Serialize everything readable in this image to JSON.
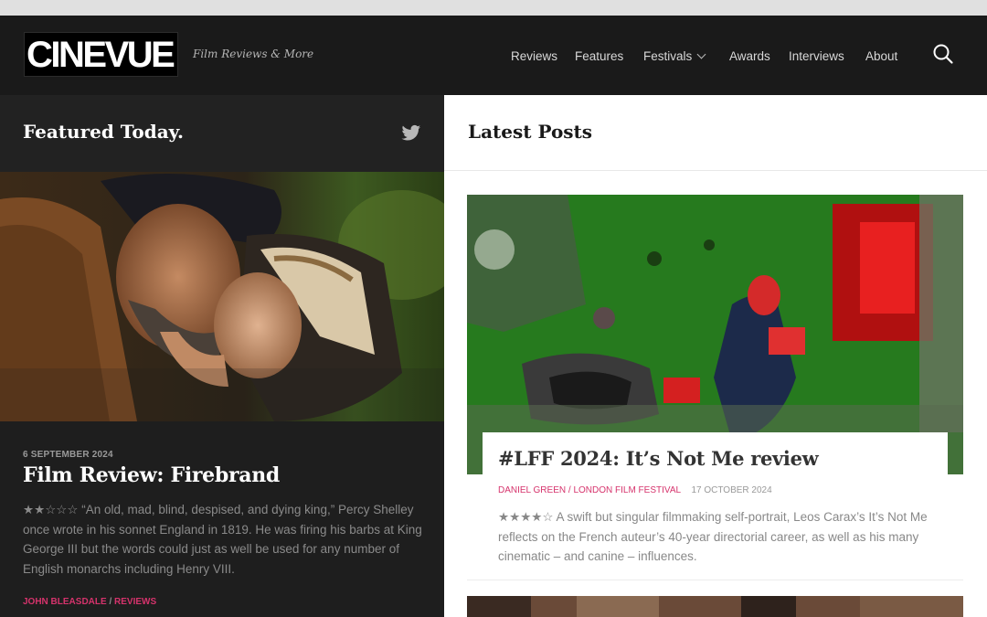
{
  "site": {
    "logo_text": "CINEVUE",
    "tagline": "Film Reviews & More"
  },
  "nav": {
    "items": [
      {
        "label": "Reviews"
      },
      {
        "label": "Features"
      },
      {
        "label": "Festivals"
      },
      {
        "label": "Awards"
      },
      {
        "label": "Interviews"
      },
      {
        "label": "About"
      }
    ],
    "icons": {
      "dropdown": "chevron-down-icon",
      "search": "search-icon"
    }
  },
  "featured": {
    "heading": "Featured Today.",
    "social_icon": "twitter-icon",
    "article": {
      "date": "6 SEPTEMBER 2024",
      "title": "Film Review: Firebrand",
      "rating": "★★☆☆☆",
      "excerpt": "“An old, mad, blind, despised, and dying king,” Percy Shelley once wrote in his sonnet England in 1819. He was firing his barbs at King George III but the words could just as well be used for any number of English monarchs including Henry VIII.",
      "author": "JOHN BLEASDALE",
      "separator": "/",
      "category": "REVIEWS"
    }
  },
  "latest": {
    "heading": "Latest Posts",
    "posts": [
      {
        "title": "#LFF 2024: It’s Not Me review",
        "author": "DANIEL GREEN",
        "separator": "/",
        "category": "LONDON FILM FESTIVAL",
        "date": "17 OCTOBER 2024",
        "rating": "★★★★☆",
        "excerpt": "A swift but singular filmmaking self-portrait, Leos Carax’s It’s Not Me reflects on the French auteur’s 40-year directorial career, as well as his many cinematic – and canine – influences."
      }
    ]
  },
  "colors": {
    "header_bg": "#1a1a1a",
    "accent_pink": "#d6336c",
    "featured_bg": "#1e1e1e"
  }
}
